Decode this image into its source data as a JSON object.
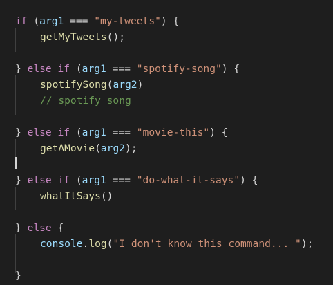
{
  "code_lines": [
    {
      "row": 0,
      "tokens": [
        {
          "t": "kw",
          "v": "if"
        },
        {
          "t": "punc",
          "v": " ("
        },
        {
          "t": "var",
          "v": "arg1"
        },
        {
          "t": "op",
          "v": " === "
        },
        {
          "t": "str",
          "v": "\"my-tweets\""
        },
        {
          "t": "punc",
          "v": ") {"
        }
      ]
    },
    {
      "row": 1,
      "indent": 2,
      "tokens": [
        {
          "t": "fn",
          "v": "getMyTweets"
        },
        {
          "t": "punc",
          "v": "();"
        }
      ]
    },
    {
      "row": 2,
      "tokens": []
    },
    {
      "row": 3,
      "tokens": [
        {
          "t": "punc",
          "v": "} "
        },
        {
          "t": "kw",
          "v": "else if"
        },
        {
          "t": "punc",
          "v": " ("
        },
        {
          "t": "var",
          "v": "arg1"
        },
        {
          "t": "op",
          "v": " === "
        },
        {
          "t": "str",
          "v": "\"spotify-song\""
        },
        {
          "t": "punc",
          "v": ") {"
        }
      ]
    },
    {
      "row": 4,
      "indent": 2,
      "tokens": [
        {
          "t": "fn",
          "v": "spotifySong"
        },
        {
          "t": "punc",
          "v": "("
        },
        {
          "t": "var",
          "v": "arg2"
        },
        {
          "t": "punc",
          "v": ")"
        }
      ]
    },
    {
      "row": 5,
      "indent": 2,
      "tokens": [
        {
          "t": "cm",
          "v": "// spotify song"
        }
      ]
    },
    {
      "row": 6,
      "tokens": []
    },
    {
      "row": 7,
      "tokens": [
        {
          "t": "punc",
          "v": "} "
        },
        {
          "t": "kw",
          "v": "else if"
        },
        {
          "t": "punc",
          "v": " ("
        },
        {
          "t": "var",
          "v": "arg1"
        },
        {
          "t": "op",
          "v": " === "
        },
        {
          "t": "str",
          "v": "\"movie-this\""
        },
        {
          "t": "punc",
          "v": ") {"
        }
      ]
    },
    {
      "row": 8,
      "indent": 2,
      "tokens": [
        {
          "t": "fn",
          "v": "getAMovie"
        },
        {
          "t": "punc",
          "v": "("
        },
        {
          "t": "var",
          "v": "arg2"
        },
        {
          "t": "punc",
          "v": ");"
        }
      ]
    },
    {
      "row": 9,
      "tokens": []
    },
    {
      "row": 10,
      "tokens": [
        {
          "t": "punc",
          "v": "} "
        },
        {
          "t": "kw",
          "v": "else if"
        },
        {
          "t": "punc",
          "v": " ("
        },
        {
          "t": "var",
          "v": "arg1"
        },
        {
          "t": "op",
          "v": " === "
        },
        {
          "t": "str",
          "v": "\"do-what-it-says\""
        },
        {
          "t": "punc",
          "v": ") {"
        }
      ]
    },
    {
      "row": 11,
      "indent": 2,
      "tokens": [
        {
          "t": "fn",
          "v": "whatItSays"
        },
        {
          "t": "punc",
          "v": "()"
        }
      ]
    },
    {
      "row": 12,
      "tokens": []
    },
    {
      "row": 13,
      "tokens": [
        {
          "t": "punc",
          "v": "} "
        },
        {
          "t": "kw",
          "v": "else"
        },
        {
          "t": "punc",
          "v": " {"
        }
      ]
    },
    {
      "row": 14,
      "indent": 2,
      "tokens": [
        {
          "t": "var",
          "v": "console"
        },
        {
          "t": "punc",
          "v": "."
        },
        {
          "t": "fn",
          "v": "log"
        },
        {
          "t": "punc",
          "v": "("
        },
        {
          "t": "str",
          "v": "\"I don't know this command... \""
        },
        {
          "t": "punc",
          "v": ");"
        }
      ]
    },
    {
      "row": 15,
      "tokens": []
    },
    {
      "row": 16,
      "tokens": [
        {
          "t": "punc",
          "v": "}"
        }
      ]
    }
  ],
  "colors": {
    "background": "#1e1e1e",
    "keyword": "#c586c0",
    "variable": "#9cdcfe",
    "string": "#ce9178",
    "function": "#dcdcaa",
    "comment": "#6a9955",
    "punctuation": "#d4d4d4"
  }
}
